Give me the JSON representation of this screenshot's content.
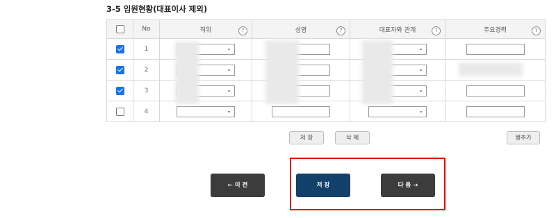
{
  "section": {
    "title": "3-5 임원현황(대표이사 제외)"
  },
  "table": {
    "headers": {
      "no": "No",
      "position": "직위",
      "name": "성명",
      "relation": "대표자와 관계",
      "career": "주요경력"
    },
    "help_icon": "?",
    "chevron_icon": "chevron-down-icon",
    "rows": [
      {
        "no": "1",
        "checked": true
      },
      {
        "no": "2",
        "checked": true
      },
      {
        "no": "3",
        "checked": true
      },
      {
        "no": "4",
        "checked": false
      }
    ]
  },
  "actions": {
    "save_label": "저 장",
    "delete_label": "삭 제",
    "add_row_label": "행추가"
  },
  "nav": {
    "prev_label": "← 이 전",
    "save_label": "저 장",
    "next_label": "다 음 →"
  },
  "colors": {
    "accent_blue": "#13406b",
    "dark_button": "#3c3c3c",
    "highlight_frame": "#e00000",
    "checkbox_checked": "#1a73e8"
  }
}
